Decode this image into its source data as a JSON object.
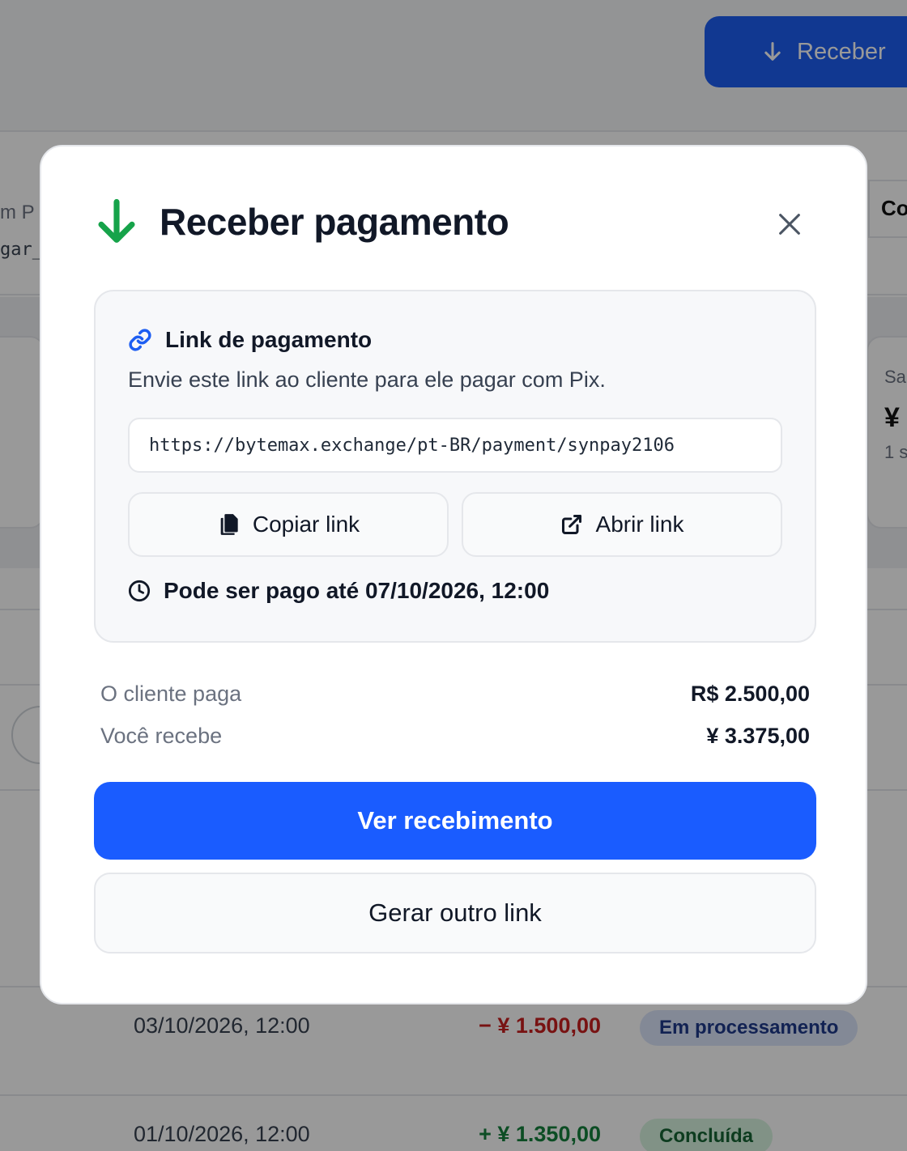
{
  "background": {
    "receive_button_label": "Receber",
    "left_fragment_line1": "m P",
    "left_fragment_line2": "gar_",
    "right_header_fragment": "Co",
    "right_card": {
      "label": "Sa",
      "value": "¥",
      "sub": "1 s"
    },
    "transactions": [
      {
        "date": "03/10/2026, 12:00",
        "amount": "− ¥ 1.500,00",
        "status": "Em processamento",
        "kind": "negative"
      },
      {
        "date": "01/10/2026, 12:00",
        "amount": "+ ¥ 1.350,00",
        "status": "Concluída",
        "kind": "positive"
      }
    ]
  },
  "modal": {
    "title": "Receber pagamento",
    "link_section": {
      "title": "Link de pagamento",
      "description": "Envie este link ao cliente para ele pagar com Pix.",
      "url": "https://bytemax.exchange/pt-BR/payment/synpay2106",
      "copy_label": "Copiar link",
      "open_label": "Abrir link",
      "expiry": "Pode ser pago até 07/10/2026, 12:00"
    },
    "summary": {
      "client_pays_label": "O cliente paga",
      "client_pays_value": "R$ 2.500,00",
      "you_receive_label": "Você recebe",
      "you_receive_value": "¥ 3.375,00"
    },
    "primary_button": "Ver recebimento",
    "secondary_button": "Gerar outro link"
  },
  "colors": {
    "accent": "#1a5cff",
    "success_arrow": "#16a34a",
    "link_icon": "#1d5ef2",
    "negative_amount": "#c81e1e",
    "positive_amount": "#15803d"
  },
  "icons": [
    "arrow-down-icon",
    "close-icon",
    "link-icon",
    "copy-icon",
    "external-link-icon",
    "clock-icon"
  ]
}
